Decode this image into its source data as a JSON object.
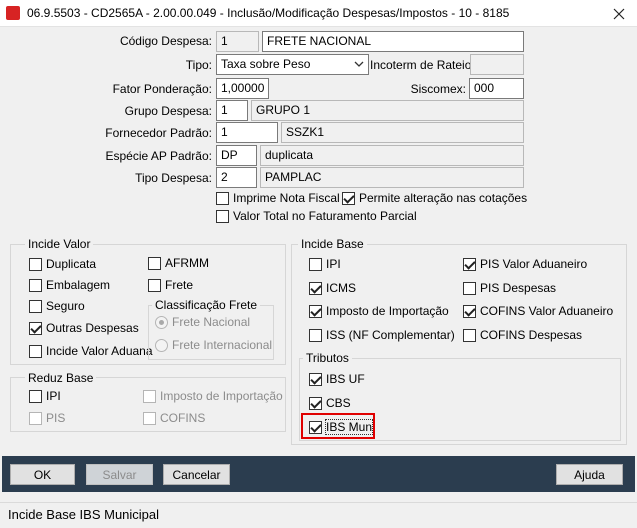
{
  "window": {
    "title": "06.9.5503 - CD2565A - 2.00.00.049 - Inclusão/Modificação Despesas/Impostos - 10 - 8185"
  },
  "form": {
    "codigo_despesa": {
      "label": "Código Despesa:",
      "code": "1",
      "desc": "FRETE NACIONAL"
    },
    "tipo": {
      "label": "Tipo:",
      "value": "Taxa sobre Peso"
    },
    "incoterm": {
      "label": "Incoterm de Rateio:",
      "value": ""
    },
    "fator": {
      "label": "Fator Ponderação:",
      "value": "1,00000"
    },
    "siscomex": {
      "label": "Siscomex:",
      "value": "000"
    },
    "grupo": {
      "label": "Grupo Despesa:",
      "code": "1",
      "desc": "GRUPO 1"
    },
    "fornecedor": {
      "label": "Fornecedor Padrão:",
      "code": "1",
      "desc": "SSZK1"
    },
    "especie": {
      "label": "Espécie AP Padrão:",
      "code": "DP",
      "desc": "duplicata"
    },
    "tipo_despesa": {
      "label": "Tipo Despesa:",
      "code": "2",
      "desc": "PAMPLAC"
    },
    "imprime_nf": {
      "label": "Imprime Nota Fiscal",
      "checked": false
    },
    "permite_alt": {
      "label": "Permite alteração nas cotações",
      "checked": true
    },
    "valor_total": {
      "label": "Valor Total no Faturamento Parcial",
      "checked": false
    }
  },
  "incide_valor": {
    "title": "Incide Valor",
    "duplicata": "Duplicata",
    "afrmm": "AFRMM",
    "embalagem": "Embalagem",
    "frete": "Frete",
    "seguro": "Seguro",
    "outras": "Outras Despesas",
    "incide_aduana": "Incide Valor Aduana",
    "classificacao": {
      "title": "Classificação Frete",
      "nacional": "Frete Nacional",
      "internacional": "Frete Internacional"
    }
  },
  "reduz_base": {
    "title": "Reduz Base",
    "ipi": "IPI",
    "imposto_importacao": "Imposto de Importação",
    "pis": "PIS",
    "cofins": "COFINS"
  },
  "incide_base": {
    "title": "Incide Base",
    "ipi": "IPI",
    "pis_aduaneiro": "PIS Valor Aduaneiro",
    "icms": "ICMS",
    "pis_despesas": "PIS Despesas",
    "imposto_importacao": "Imposto de Importação",
    "cofins_aduaneiro": "COFINS Valor Aduaneiro",
    "iss": "ISS (NF Complementar)",
    "cofins_despesas": "COFINS Despesas"
  },
  "tributos": {
    "title": "Tributos",
    "ibs_uf": "IBS UF",
    "cbs": "CBS",
    "ibs_mun": "IBS Mun"
  },
  "buttons": {
    "ok": "OK",
    "salvar": "Salvar",
    "cancelar": "Cancelar",
    "ajuda": "Ajuda"
  },
  "status": {
    "text": "Incide Base IBS Municipal"
  },
  "colors": {
    "toolbar": "#2b3d4f",
    "highlight": "#e00000"
  }
}
